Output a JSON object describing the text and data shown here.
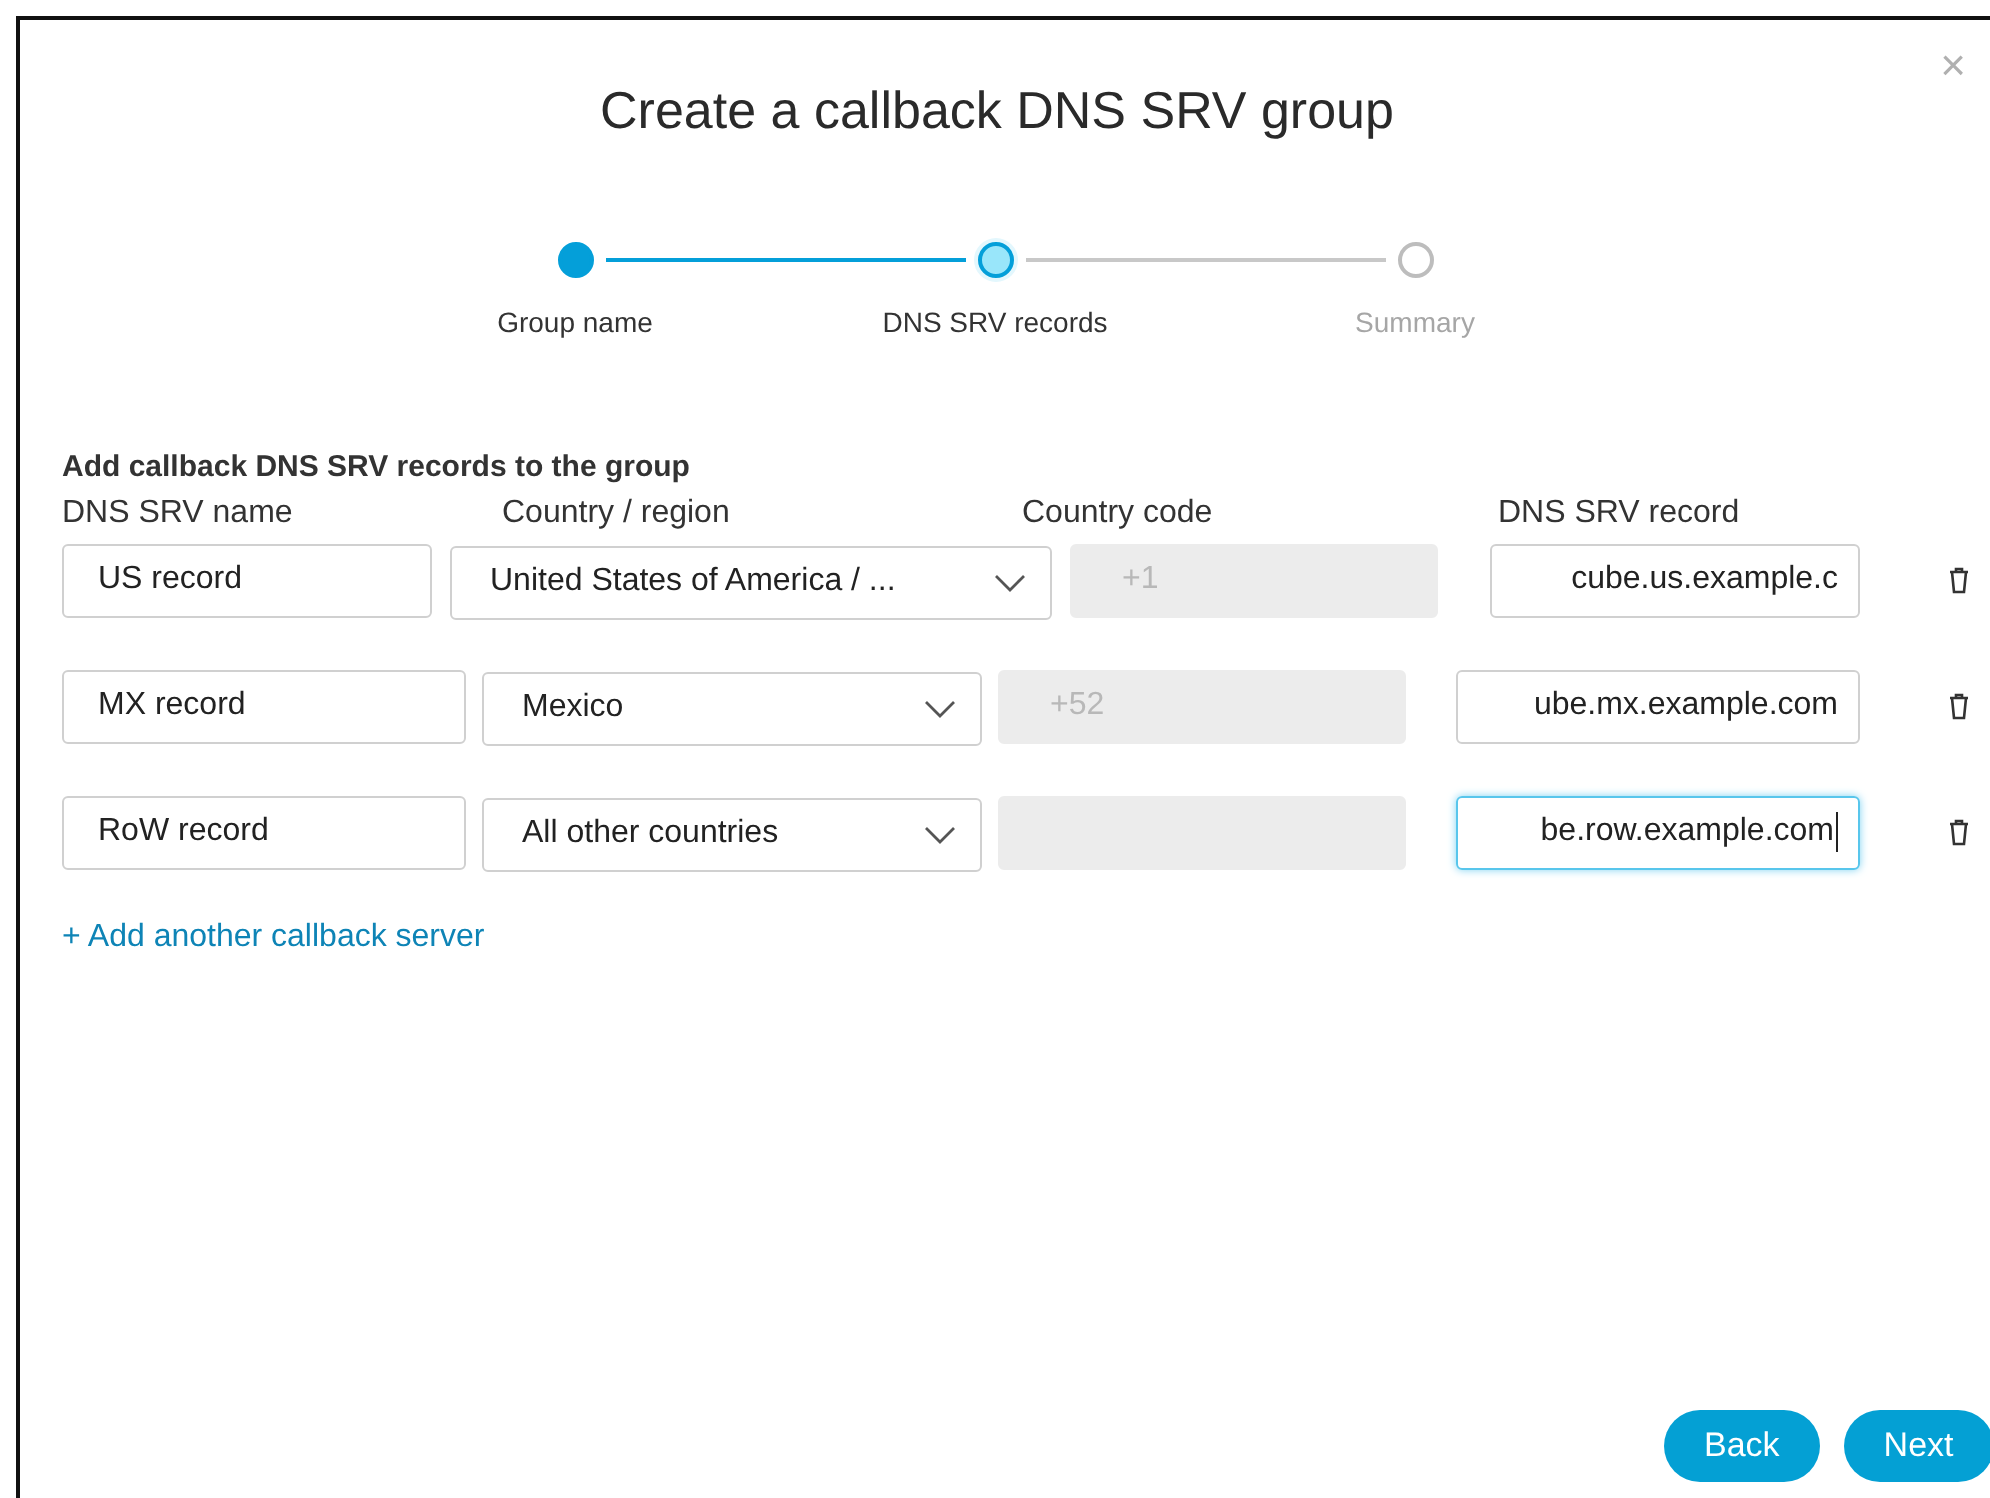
{
  "dialog": {
    "title": "Create a callback DNS SRV group",
    "close": "×"
  },
  "steps": [
    {
      "label": "Group name",
      "completed": true,
      "selected": false
    },
    {
      "label": "DNS SRV records",
      "completed": false,
      "selected": true
    },
    {
      "label": "Summary",
      "completed": false,
      "selected": false
    }
  ],
  "section_title": "Add callback DNS SRV records to the group",
  "columns": [
    "DNS SRV name",
    "Country / region",
    "Country code",
    "DNS SRV record"
  ],
  "records": [
    {
      "name": "US record",
      "country": "United States of America / ...",
      "country_code": "+1",
      "srv_record": "cube.us.example.c",
      "focused": false
    },
    {
      "name": "MX record",
      "country": "Mexico",
      "country_code": "+52",
      "srv_record": "ube.mx.example.com",
      "focused": false
    },
    {
      "name": "RoW record",
      "country": "All other countries",
      "srv_record": "be.row.example.com",
      "focused": true
    }
  ],
  "add_link": "+ Add another callback server",
  "buttons": [
    {
      "label": "Back"
    },
    {
      "label": "Next"
    }
  ]
}
